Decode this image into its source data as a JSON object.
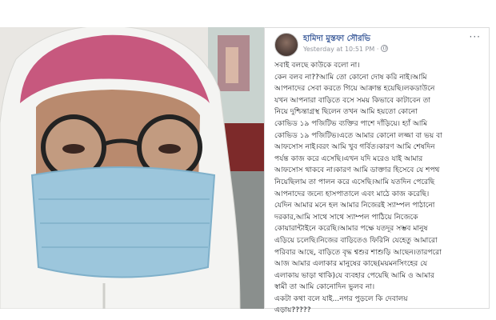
{
  "post": {
    "author_name": "হামিদা মুস্তফা সৌরভি",
    "timestamp": "Yesterday at 10:51 PM ·",
    "privacy_icon": "globe-icon",
    "more_icon": "more-options-icon",
    "more_label": "···",
    "lines": [
      "সবাই বলছে কাউকে বলো না।",
      "কেন বলব না??আমি তো কোনো দোষ করি নাই।আমি",
      "আপনাদের সেবা করতে গিয়ে আক্রান্ত হয়েছি।লকডাউনে",
      "যখন আপনারা বাড়িতে বসে সময় কিভাবে কাটাবেন তা",
      "নিয়ে দুশ্চিন্তাগ্রস্থ ছিলেন তখন আমি হয়তো কোনো",
      "কোভিড ১৯ পজিটিভ ব্যক্তির পাশে দাঁড়িয়ে। হ্যাঁ আমি",
      "কোভিড ১৯ পজিটিভ।এতে আমার কোনো লজ্জা বা ভয় বা",
      "আফসোস নাই।বরং আমি খুব গর্বিত।কারণ আমি শেষদিন",
      "পর্যন্ত কাজ করে এসেছি।এখন যদি মরেও যাই আমার",
      "আফসোস থাকবে না।কারণ আমি ডাক্তার হিসেবে যে শপথ",
      "নিয়েছিলাম তা পালন করে এসেছি।আমি যতদিন পেরেছি",
      "আপনাদের জন্যে হাসপাতালে এবং মাঠে কাজ করেছি।",
      "যেদিন আমার মনে হল আমার নিজেরই স্যাম্পল পাঠানো",
      "দরকার,আমি সাথে সাথে স্যাম্পল পাঠিয়ে নিজেকে",
      "কোয়ারান্টাইনে করেছি।আমার পক্ষে যতদূর সম্ভব মানুষ",
      "এড়িয়ে চলেছি।নিজের বাড়িতেও ফিরিনি যেহেতু আমারো",
      "পরিবার আছে, বাড়িতে বৃদ্ধ শ্বশুর শাশুড়ি আছেন।তারপরো",
      "আজ আমার এলাকার মানুষের কাছে(ময়মনসিংহের যে",
      "এলাকায় ভাড়া থাকি)যে ব্যবহার পেয়েছি আমি ও আমার",
      "স্বামী তা আমি কোনোদিন ভুলব না।",
      "একটা কথা বলে যাই...নগর পুড়লে কি দেবালয়",
      "এড়ায়?????"
    ]
  },
  "photo": {
    "subject": "selfie of woman in PPE suit, surgical mask, hood and glasses"
  }
}
